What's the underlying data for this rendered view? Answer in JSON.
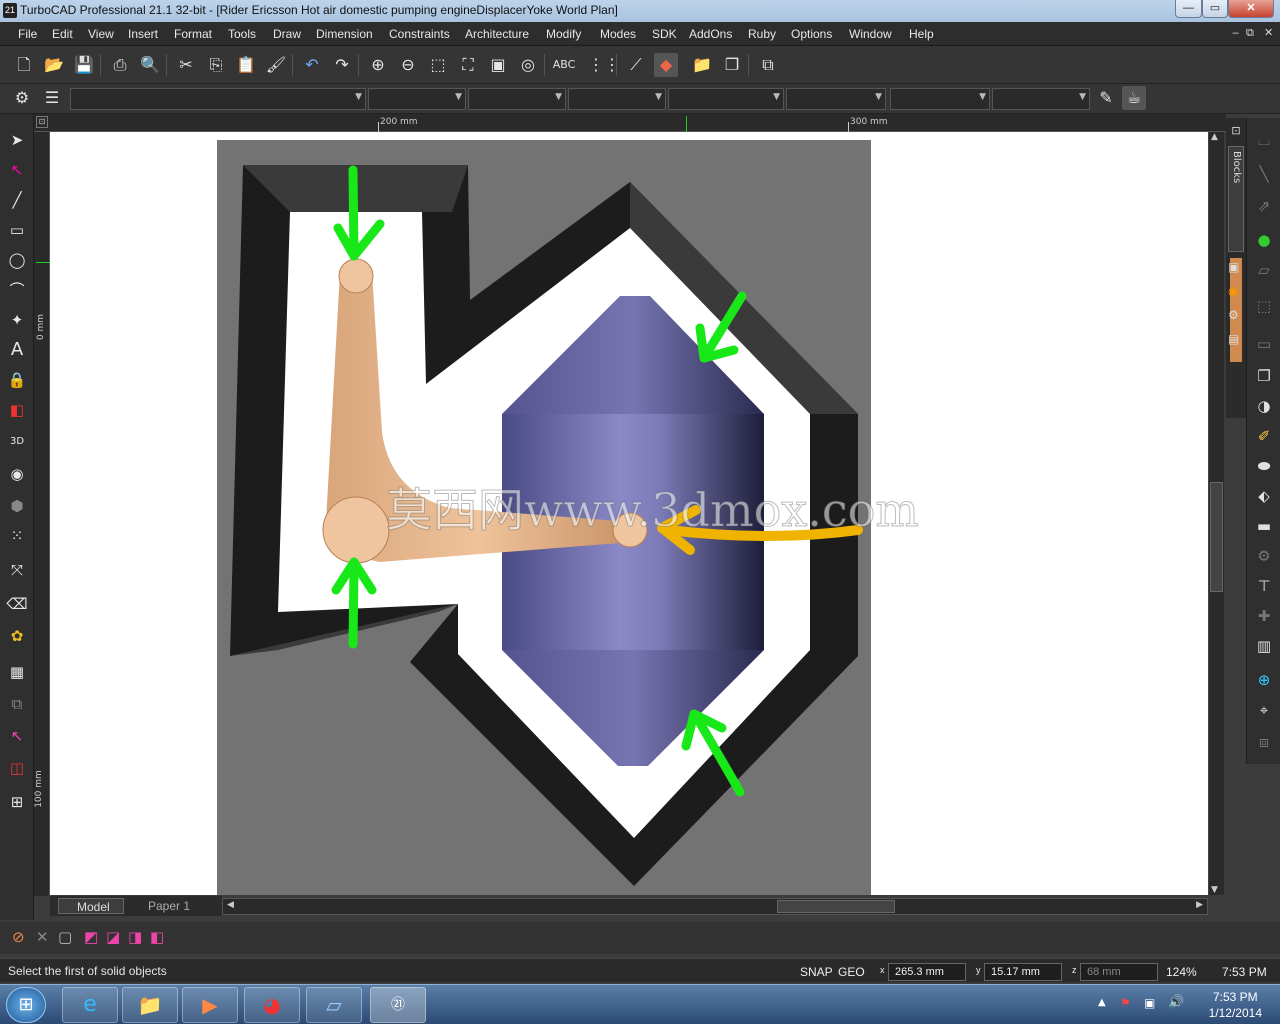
{
  "window": {
    "title": "TurboCAD Professional 21.1 32-bit - [Rider Ericsson Hot air domestic pumping engineDisplacerYoke World Plan]",
    "app_icon": "21",
    "buttons": {
      "minimize": "—",
      "maximize": "▭",
      "close": "✕"
    }
  },
  "menu": {
    "items": [
      "File",
      "Edit",
      "View",
      "Insert",
      "Format",
      "Tools",
      "Draw",
      "Dimension",
      "Constraints",
      "Architecture",
      "Modify",
      "Modes",
      "SDK",
      "AddOns",
      "Ruby",
      "Options",
      "Window",
      "Help"
    ],
    "mdi_controls": [
      "‒",
      "⧉",
      "✕"
    ]
  },
  "ruler": {
    "top_labels": [
      "200 mm",
      "300 mm"
    ],
    "left_labels": [
      "0 mm",
      "100 mm"
    ]
  },
  "side_panel": {
    "blocks_label": "Blocks"
  },
  "tabs": {
    "model": "Model",
    "paper1": "Paper 1"
  },
  "watermark": "莫西网www.3dmox.com",
  "status": {
    "message": "Select the first of solid objects",
    "snap": "SNAP",
    "geo": "GEO",
    "x_value": "265.3 mm",
    "y_value": "15.17 mm",
    "z_value": "68 mm",
    "zoom": "124%",
    "time": "7:53 PM"
  },
  "taskbar": {
    "clock_time": "7:53 PM",
    "clock_date": "1/12/2014"
  },
  "colors": {
    "accent_green": "#18e818",
    "accent_yellow": "#f0b400",
    "displacer": "#6a69a8",
    "yoke": "#e8b98e",
    "frame": "#1e1e1e"
  }
}
